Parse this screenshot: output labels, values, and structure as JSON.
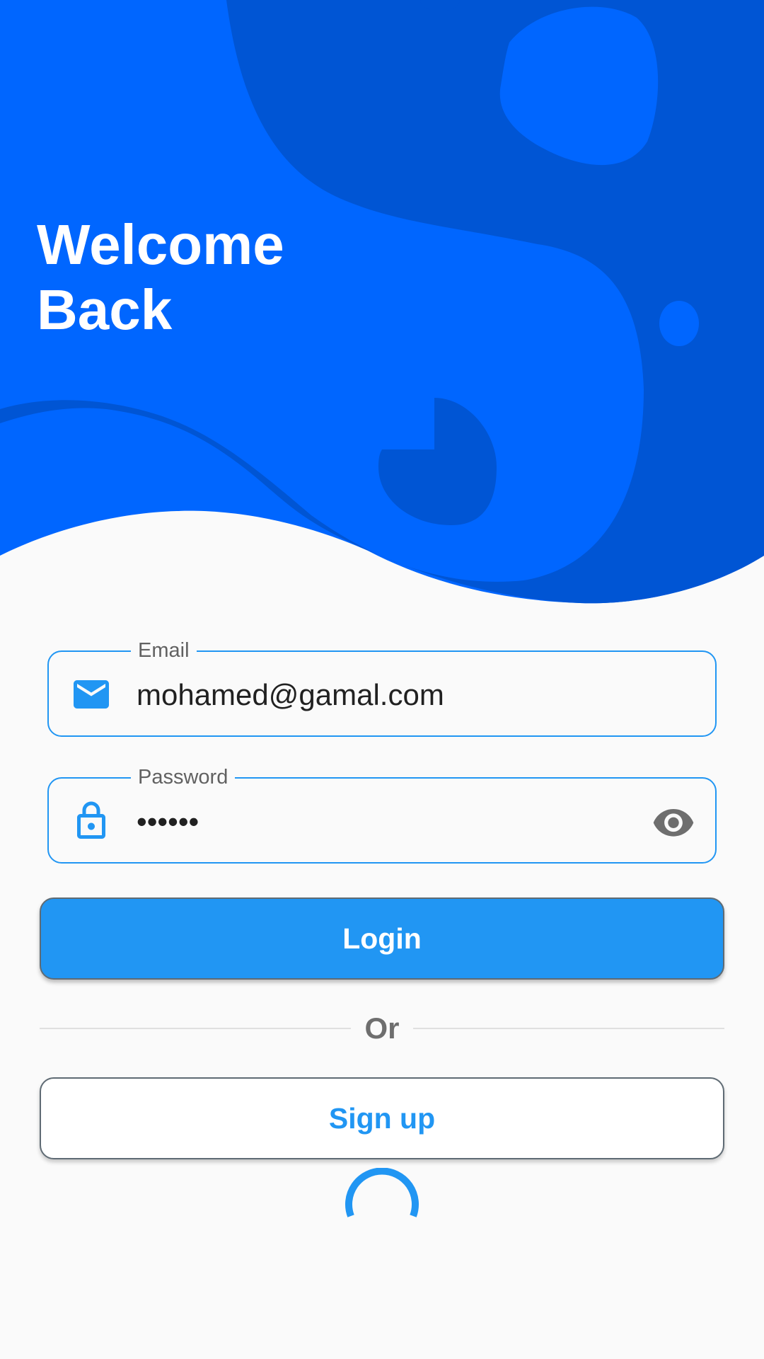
{
  "colors": {
    "header_primary": "#0066FF",
    "header_secondary": "#0055D4",
    "accent": "#2196F3",
    "background": "#FAFAFA"
  },
  "header": {
    "title_line1": "Welcome",
    "title_line2": "Back"
  },
  "email_field": {
    "label": "Email",
    "value": "mohamed@gamal.com",
    "icon": "mail-icon"
  },
  "password_field": {
    "label": "Password",
    "value": "••••••",
    "icon": "lock-icon",
    "trailing_icon": "eye-icon"
  },
  "login_button": {
    "label": "Login"
  },
  "divider": {
    "text": "Or"
  },
  "signup_button": {
    "label": "Sign up"
  },
  "loading_indicator": {
    "icon": "progress-spinner-icon"
  }
}
